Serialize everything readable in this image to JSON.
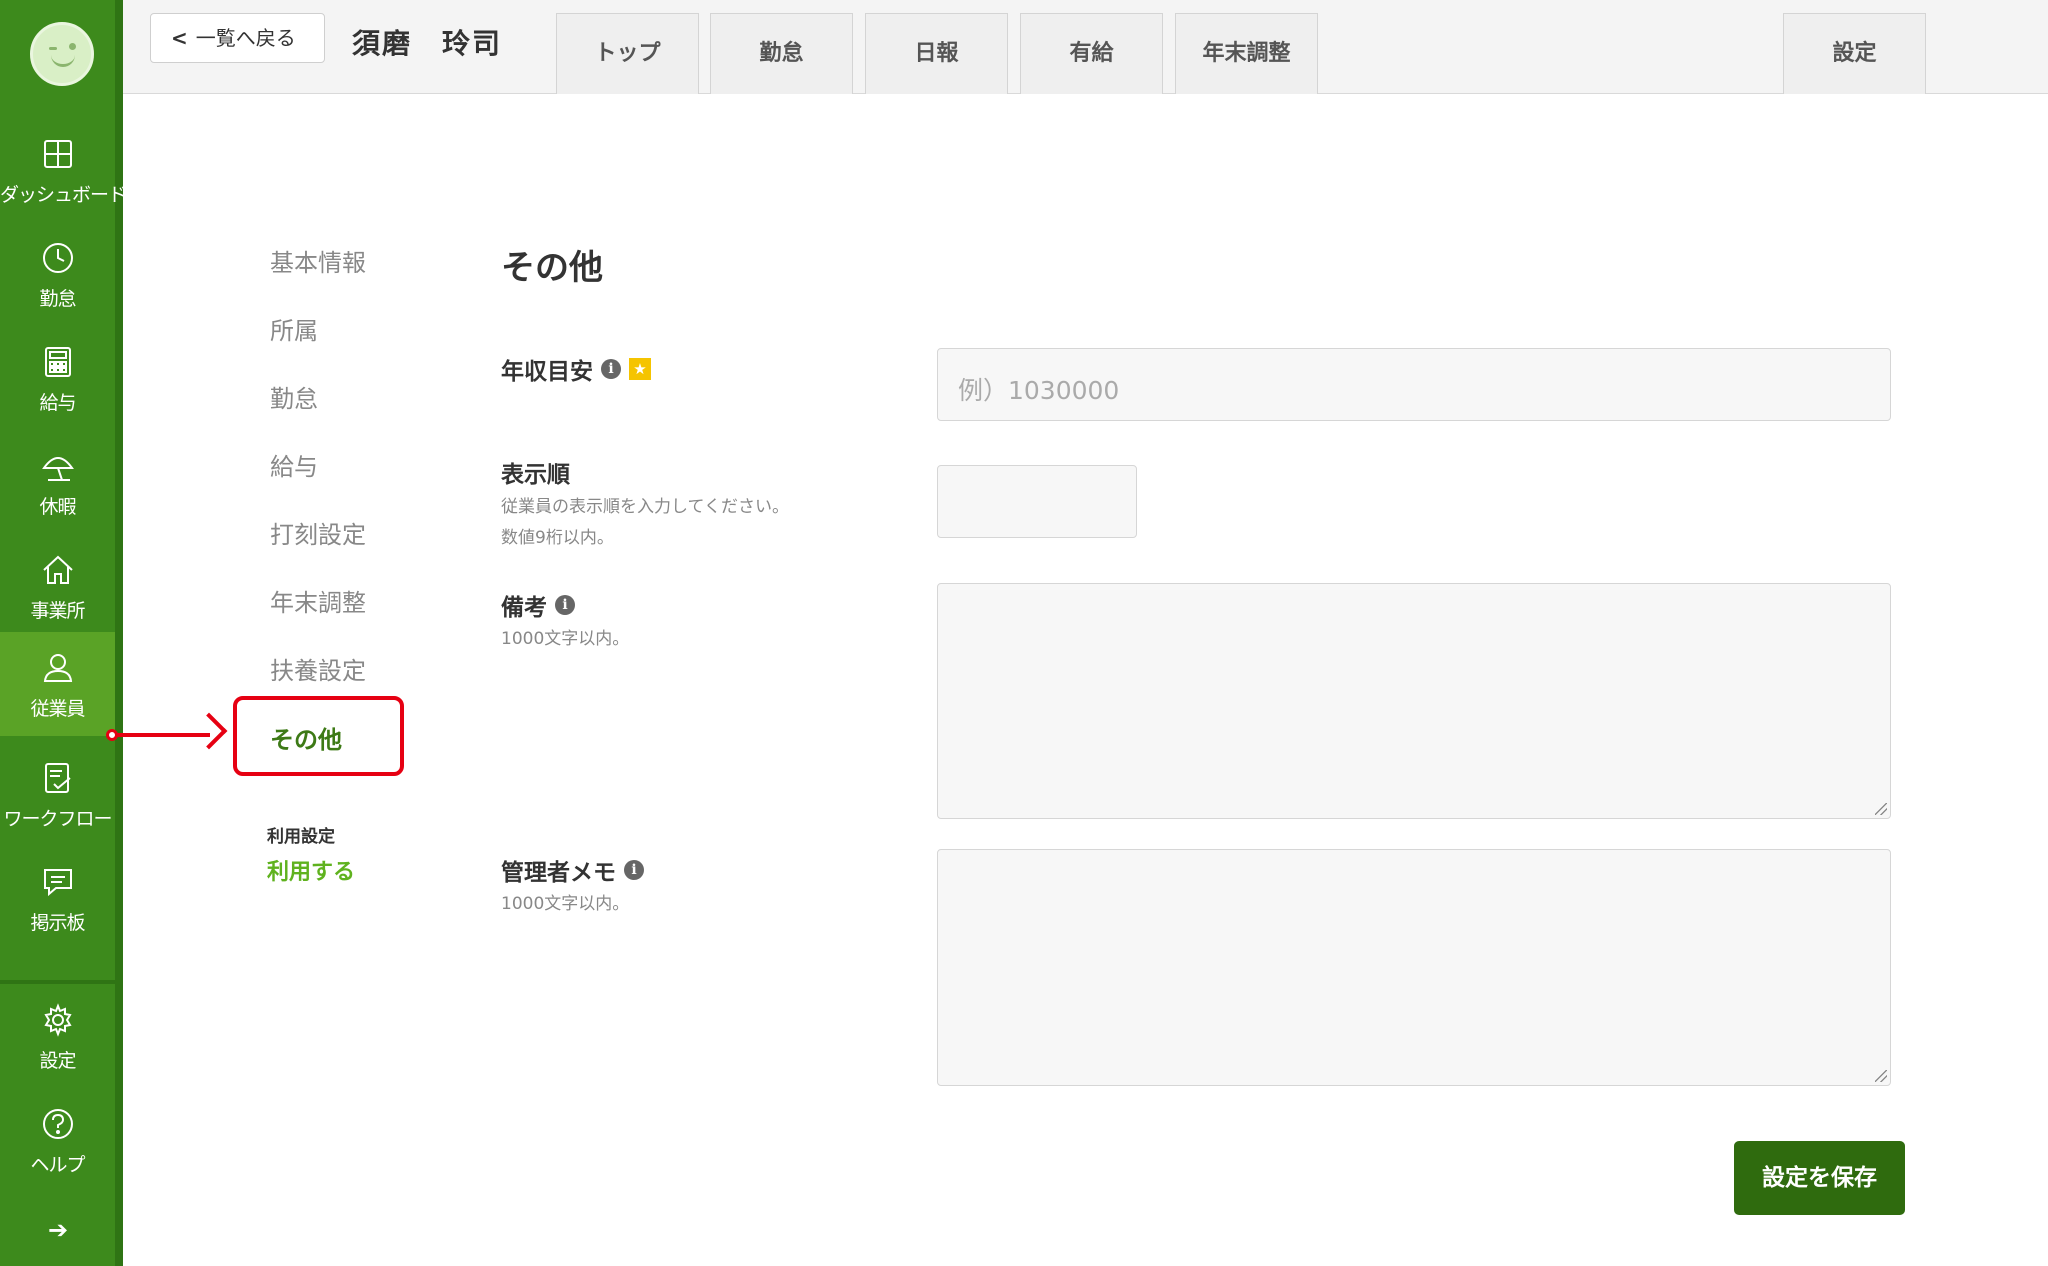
{
  "sidebar": {
    "items": [
      {
        "label": "ダッシュボード",
        "icon": "dashboard-icon"
      },
      {
        "label": "勤怠",
        "icon": "clock-icon"
      },
      {
        "label": "給与",
        "icon": "calculator-icon"
      },
      {
        "label": "休暇",
        "icon": "umbrella-icon"
      },
      {
        "label": "事業所",
        "icon": "home-icon"
      },
      {
        "label": "従業員",
        "icon": "user-icon"
      },
      {
        "label": "ワークフロー",
        "icon": "document-check-icon"
      },
      {
        "label": "掲示板",
        "icon": "message-icon"
      },
      {
        "label": "設定",
        "icon": "gear-icon"
      },
      {
        "label": "ヘルプ",
        "icon": "help-icon"
      }
    ],
    "active_item": "従業員",
    "collapse_arrow": "➔",
    "colors": {
      "background": "#3d8a1c",
      "active": "#5aa326"
    }
  },
  "header": {
    "back_label": "一覧へ戻る",
    "employee_name": "須磨　玲司",
    "tabs": [
      "トップ",
      "勤怠",
      "日報",
      "有給",
      "年末調整"
    ],
    "settings_tab": "設定"
  },
  "submenu": {
    "items": [
      "基本情報",
      "所属",
      "勤怠",
      "給与",
      "打刻設定",
      "年末調整",
      "扶養設定",
      "その他"
    ],
    "active": "その他",
    "use_setting_label": "利用設定",
    "use_setting_value": "利用する"
  },
  "main": {
    "title": "その他",
    "fields": {
      "annual_income": {
        "label": "年収目安",
        "placeholder": "例）1030000",
        "value": ""
      },
      "display_order": {
        "label": "表示順",
        "help": [
          "従業員の表示順を入力してください。",
          "数値9桁以内。"
        ],
        "value": ""
      },
      "remarks": {
        "label": "備考",
        "help": "1000文字以内。",
        "value": ""
      },
      "admin_memo": {
        "label": "管理者メモ",
        "help": "1000文字以内。",
        "value": ""
      }
    },
    "save_label": "設定を保存"
  },
  "annotation": {
    "highlight_color": "#e60012"
  }
}
